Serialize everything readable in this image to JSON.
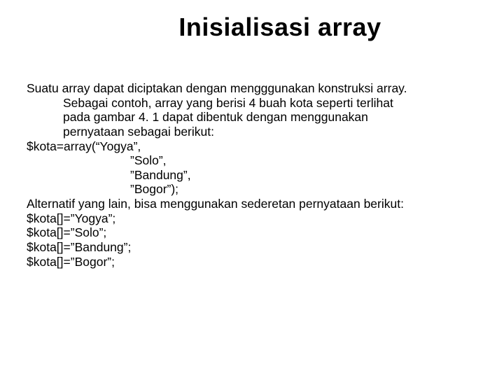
{
  "title": "Inisialisasi array",
  "intro_line1": "Suatu array dapat diciptakan dengan mengggunakan konstruksi array.",
  "intro_line2": "Sebagai contoh, array yang berisi 4 buah kota seperti terlihat",
  "intro_line3": "pada gambar 4. 1 dapat dibentuk dengan menggunakan",
  "intro_line4": "pernyataan sebagai berikut:",
  "code1_l1": "$kota=array(“Yogya”,",
  "code1_l2": "”Solo”,",
  "code1_l3": "”Bandung”,",
  "code1_l4": "”Bogor”);",
  "alt": "Alternatif yang lain, bisa menggunakan sederetan pernyataan berikut:",
  "code2_l1": "$kota[]=”Yogya”;",
  "code2_l2": "$kota[]=”Solo”;",
  "code2_l3": "$kota[]=”Bandung”;",
  "code2_l4": "$kota[]=”Bogor”;"
}
